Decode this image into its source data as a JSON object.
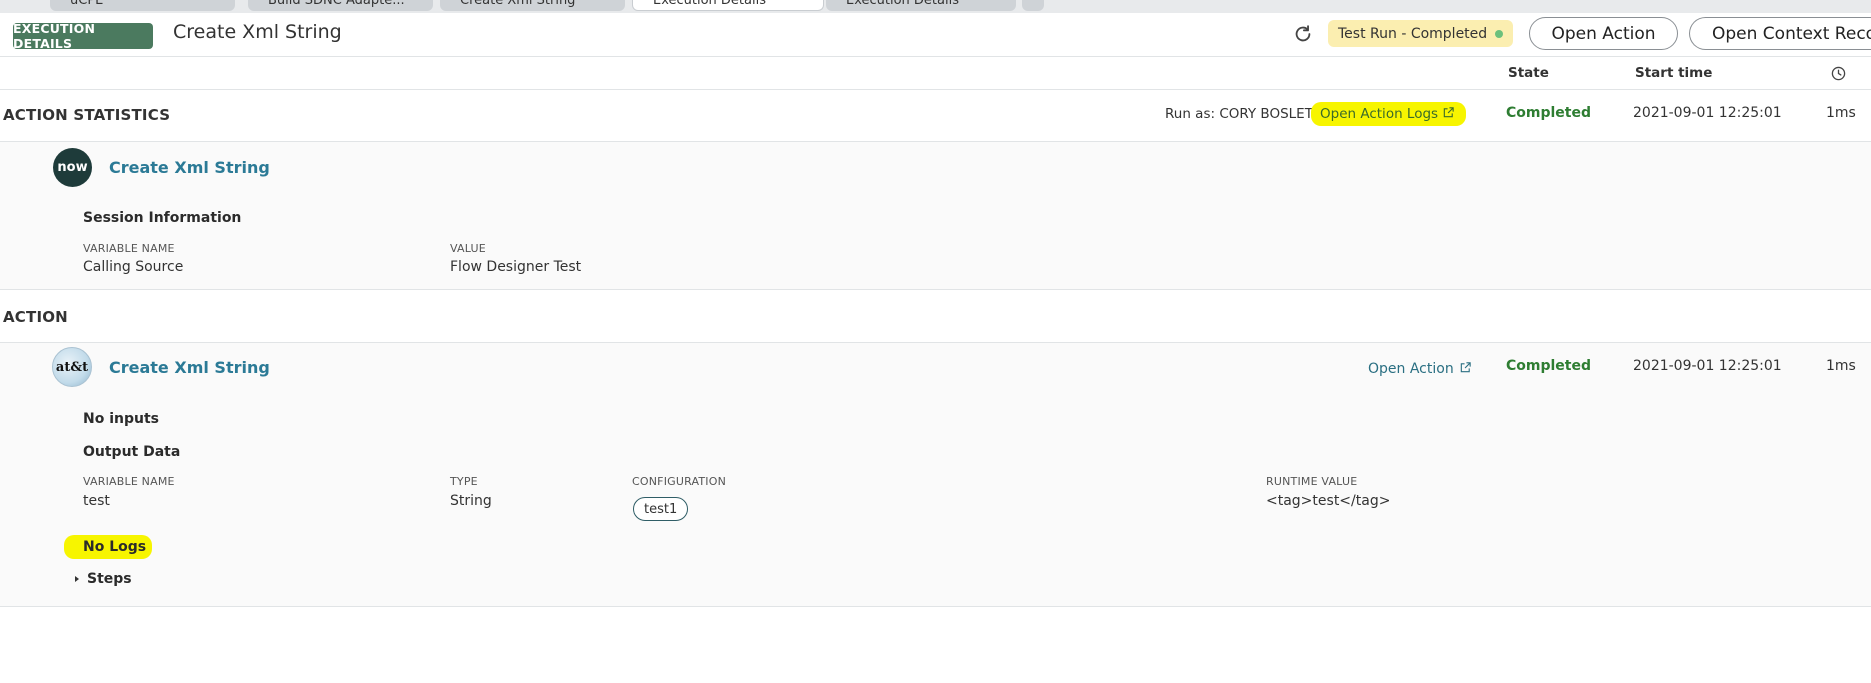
{
  "tabs": [
    {
      "label": "uCPE"
    },
    {
      "label": "Build SDNC Adapte..."
    },
    {
      "label": "Create Xml String"
    },
    {
      "label": "Execution Details"
    },
    {
      "label": "Execution Details"
    }
  ],
  "header": {
    "badge": "EXECUTION DETAILS",
    "title": "Create Xml String",
    "status": "Test Run - Completed",
    "open_action": "Open Action",
    "open_context": "Open Context Record"
  },
  "columns": {
    "state": "State",
    "start_time": "Start time"
  },
  "action_statistics": {
    "title": "ACTION STATISTICS",
    "run_as": "Run as: CORY BOSLET",
    "open_logs": "Open Action Logs",
    "state": "Completed",
    "start": "2021-09-01 12:25:01",
    "duration": "1ms",
    "item": {
      "logo": "now",
      "name": "Create Xml String",
      "session_title": "Session Information",
      "var_header": "VARIABLE NAME",
      "value_header": "VALUE",
      "var_name": "Calling Source",
      "var_value": "Flow Designer Test"
    }
  },
  "action": {
    "title": "ACTION",
    "item": {
      "logo": "at&t",
      "name": "Create Xml String",
      "open_action": "Open Action",
      "state": "Completed",
      "start": "2021-09-01 12:25:01",
      "duration": "1ms",
      "no_inputs": "No inputs",
      "output_title": "Output Data",
      "headers": {
        "var": "VARIABLE NAME",
        "type": "TYPE",
        "config": "CONFIGURATION",
        "runtime": "RUNTIME VALUE"
      },
      "row": {
        "var": "test",
        "type": "String",
        "config": "test1",
        "runtime": "<tag>test</tag>"
      },
      "no_logs": "No Logs",
      "steps": "Steps"
    }
  },
  "colors": {
    "badge": "#4b7a5f",
    "completed": "#2e7d32",
    "link": "#2b7a96",
    "highlight": "#f7f500",
    "status_pill": "#fbeeb0"
  },
  "icons": [
    "refresh-icon",
    "clock-icon",
    "external-link-icon",
    "caret-right-icon"
  ]
}
